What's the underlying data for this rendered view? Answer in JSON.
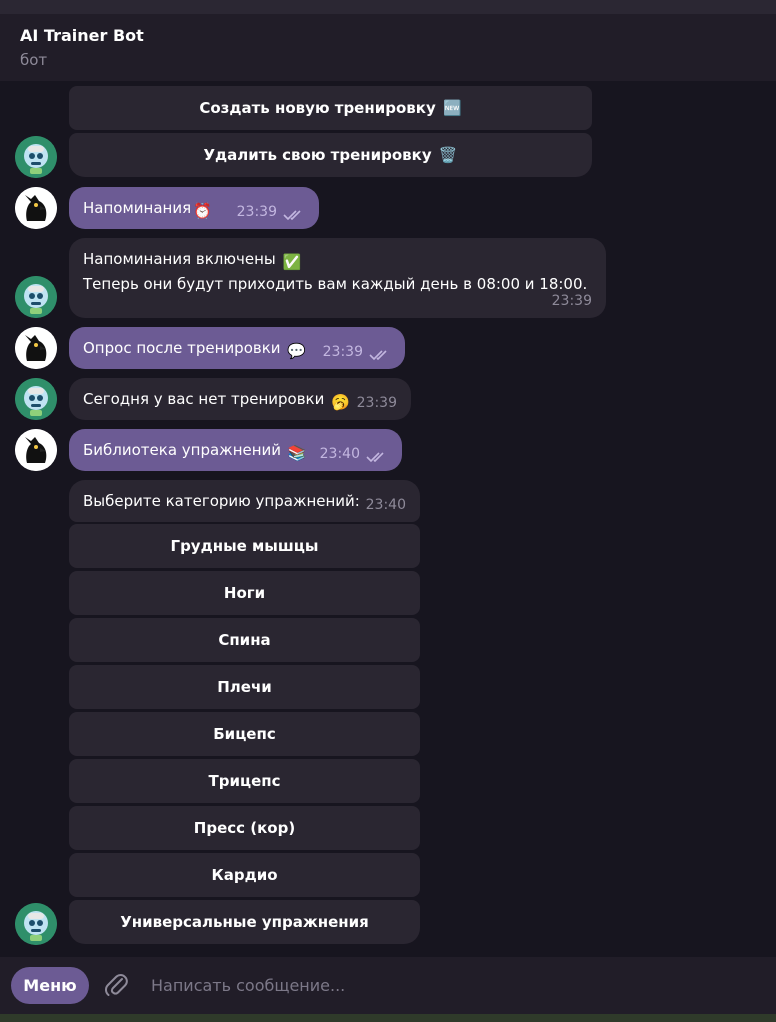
{
  "header": {
    "title": "AI Trainer Bot",
    "subtitle": "бот"
  },
  "top_keyboard": [
    {
      "label": "Создать новую тренировку",
      "emoji": "🆕"
    },
    {
      "label": "Удалить свою тренировку",
      "emoji": "🗑️"
    }
  ],
  "messages": [
    {
      "text": "Напоминания",
      "emoji": "⏰",
      "time": "23:39"
    },
    {
      "line1": "Напоминания включены",
      "emoji": "✅",
      "line2": "Теперь они будут приходить вам каждый день в 08:00 и 18:00.",
      "time": "23:39"
    },
    {
      "text": "Опрос после тренировки",
      "emoji": "💬",
      "time": "23:39"
    },
    {
      "text": "Сегодня у вас нет тренировки",
      "emoji": "🥱",
      "time": "23:39"
    },
    {
      "text": "Библиотека упражнений",
      "emoji": "📚",
      "time": "23:40"
    },
    {
      "text": "Выберите категорию упражнений:",
      "time": "23:40"
    }
  ],
  "category_keyboard": [
    "Грудные мышцы",
    "Ноги",
    "Спина",
    "Плечи",
    "Бицепс",
    "Трицепс",
    "Пресс (кор)",
    "Кардио",
    "Универсальные упражнения"
  ],
  "composer": {
    "menu_label": "Меню",
    "placeholder": "Написать сообщение..."
  },
  "colors": {
    "accent": "#6c5b94",
    "incoming": "#2a2631",
    "background": "#17151f"
  }
}
